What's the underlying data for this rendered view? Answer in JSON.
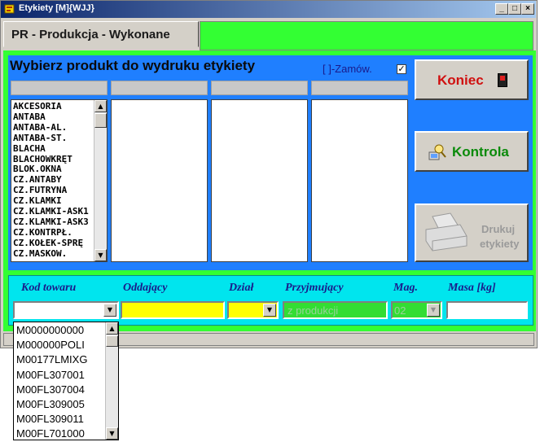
{
  "window": {
    "title": "Etykiety [M]{WJJ}",
    "min_label": "_",
    "max_label": "□",
    "close_label": "×"
  },
  "tab": {
    "label": "PR - Produkcja - Wykonane"
  },
  "panel": {
    "heading": "Wybierz produkt do wydruku etykiety",
    "zamow_label": "[ ]-Zamów.",
    "zamow_checked_mark": "✓",
    "product_list": [
      "AKCESORIA",
      "ANTABA",
      "ANTABA-AL.",
      "ANTABA-ST.",
      "BLACHA",
      "BLACHOWKRĘT",
      "BLOK.OKNA",
      "CZ.ANTABY",
      "CZ.FUTRYNA",
      "CZ.KLAMKI",
      "CZ.KLAMKI-ASK1",
      "CZ.KLAMKI-ASK3",
      "CZ.KONTRPŁ.",
      "CZ.KOŁEK-SPRĘ",
      "CZ.MASKOW."
    ]
  },
  "buttons": {
    "koniec": "Koniec",
    "kontrola": "Kontrola",
    "drukuj_line1": "Drukuj",
    "drukuj_line2": "etykiety"
  },
  "form": {
    "labels": {
      "kod_towaru": "Kod towaru",
      "oddajacy": "Oddający",
      "dzial": "Dział",
      "przyjmujacy": "Przyjmujący",
      "mag": "Mag.",
      "masa": "Masa [kg]"
    },
    "values": {
      "kod_towaru": "",
      "oddajacy": "",
      "dzial": "",
      "przyjmujacy": "z produkcji",
      "mag": "02",
      "masa": ""
    }
  },
  "dropdown": {
    "items": [
      "M0000000000",
      "M000000POLI",
      "M00177LMIXG",
      "M00FL307001",
      "M00FL307004",
      "M00FL309005",
      "M00FL309011",
      "M00FL701000"
    ]
  },
  "colors": {
    "blue_panel": "#1f7fff",
    "green_frame": "#33ff33",
    "cyan_form": "#00e5ee",
    "yellow_field": "#ffff00",
    "koniec_red": "#d01010",
    "kontrola_green": "#0a8a0a"
  },
  "icons": {
    "app": "label-app-icon",
    "koniec": "exit-door-icon",
    "kontrola": "magnifier-computer-icon",
    "drukuj": "printer-icon"
  }
}
